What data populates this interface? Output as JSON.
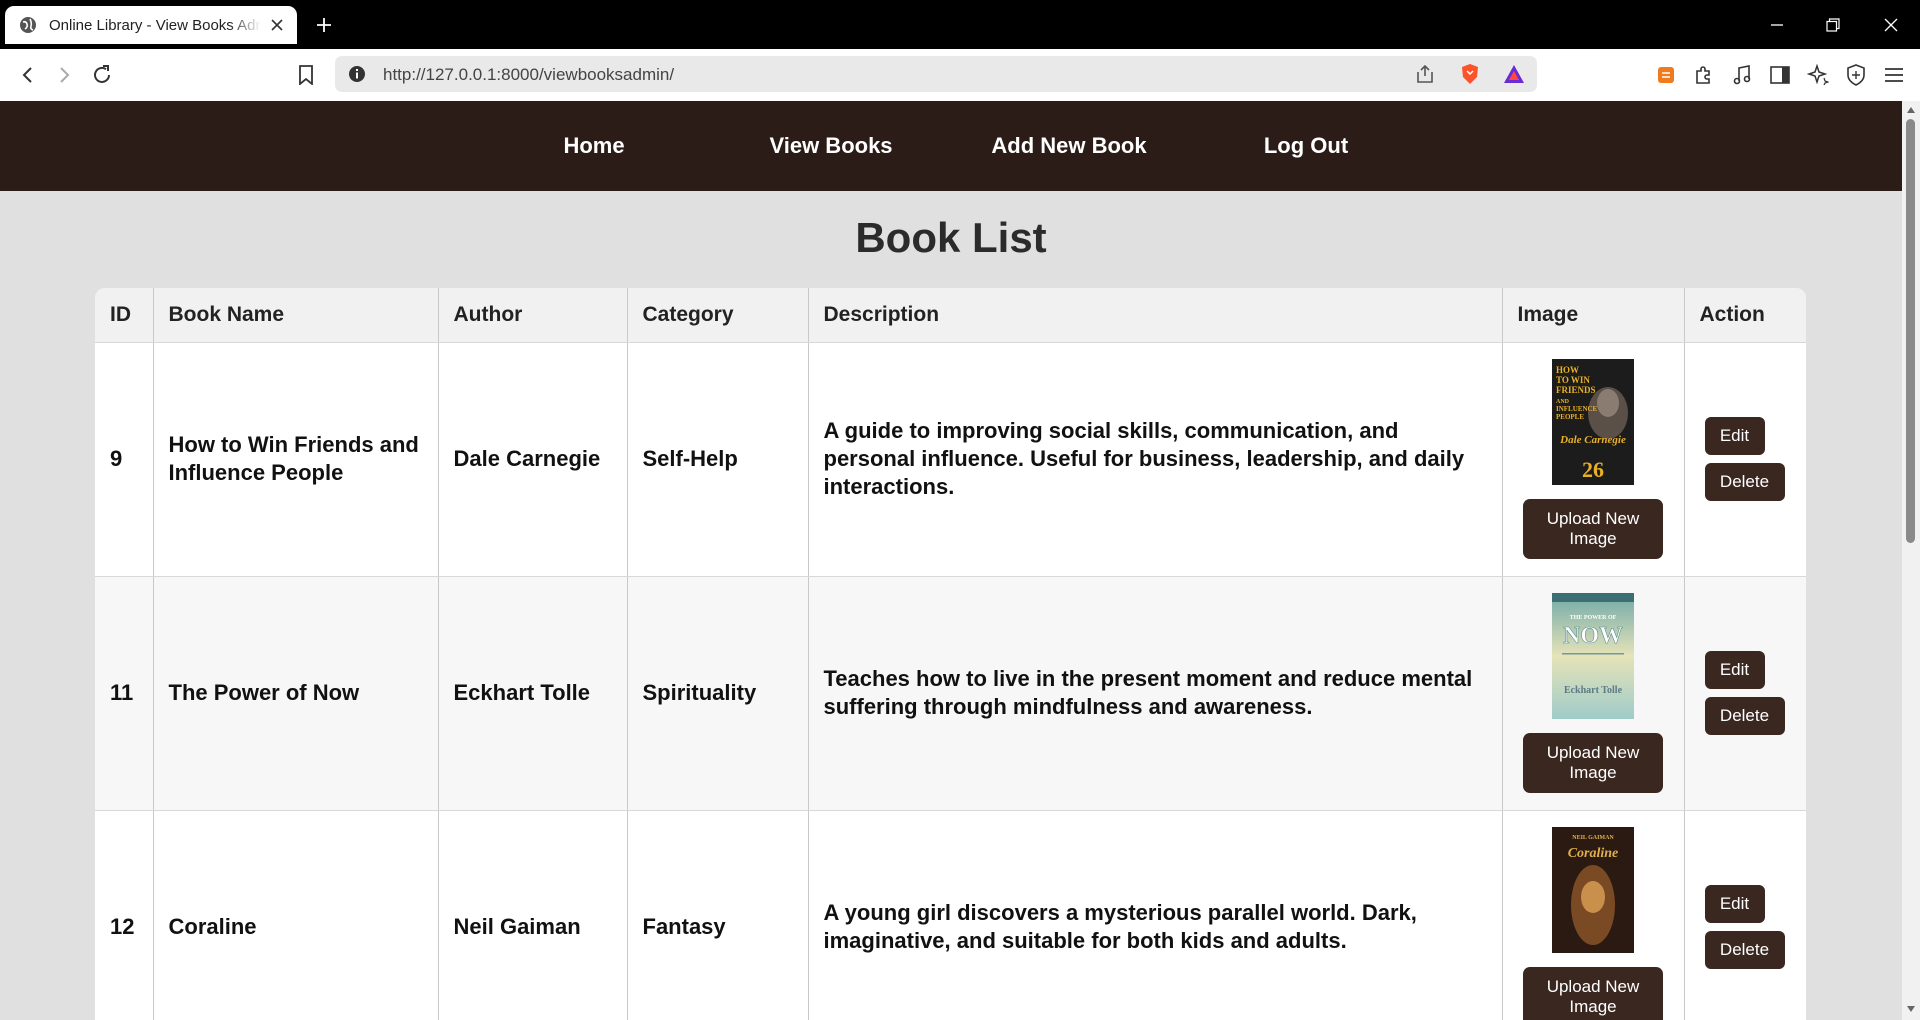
{
  "browser": {
    "tab_title": "Online Library - View Books Admin",
    "url": "http://127.0.0.1:8000/viewbooksadmin/"
  },
  "nav": {
    "items": [
      {
        "label": "Home"
      },
      {
        "label": "View Books"
      },
      {
        "label": "Add New Book"
      },
      {
        "label": "Log Out"
      }
    ]
  },
  "page": {
    "title": "Book List"
  },
  "table": {
    "headers": [
      "ID",
      "Book Name",
      "Author",
      "Category",
      "Description",
      "Image",
      "Action"
    ],
    "rows": [
      {
        "id": "9",
        "name": "How to Win Friends and Influence People",
        "author": "Dale Carnegie",
        "category": "Self-Help",
        "description": "A guide to improving social skills, communication, and personal influence. Useful for business, leadership, and daily interactions.",
        "cover": {
          "title": "HOW TO WIN FRIENDS AND INFLUENCE PEOPLE",
          "author": "Dale Carnegie",
          "badge": "26",
          "colors": {
            "bg": "#1c1c1c",
            "text": "#e8b028"
          }
        }
      },
      {
        "id": "11",
        "name": "The Power of Now",
        "author": "Eckhart Tolle",
        "category": "Spirituality",
        "description": "Teaches how to live in the present moment and reduce mental suffering through mindfulness and awareness.",
        "cover": {
          "title": "NOW",
          "author": "Eckhart Tolle",
          "colors": {
            "bg": "#a9cfc8",
            "text": "#ffffff"
          }
        }
      },
      {
        "id": "12",
        "name": "Coraline",
        "author": "Neil Gaiman",
        "category": "Fantasy",
        "description": "A young girl discovers a mysterious parallel world. Dark, imaginative, and suitable for both kids and adults.",
        "cover": {
          "title": "Coraline",
          "author": "NEIL GAIMAN",
          "colors": {
            "bg": "#2a1a12",
            "text": "#e0b04a"
          }
        }
      }
    ],
    "upload_label": "Upload New Image",
    "edit_label": "Edit",
    "delete_label": "Delete"
  },
  "colors": {
    "nav_bg": "#2b1c17",
    "button_bg": "#3a2720",
    "page_bg": "#e0e0e0"
  }
}
